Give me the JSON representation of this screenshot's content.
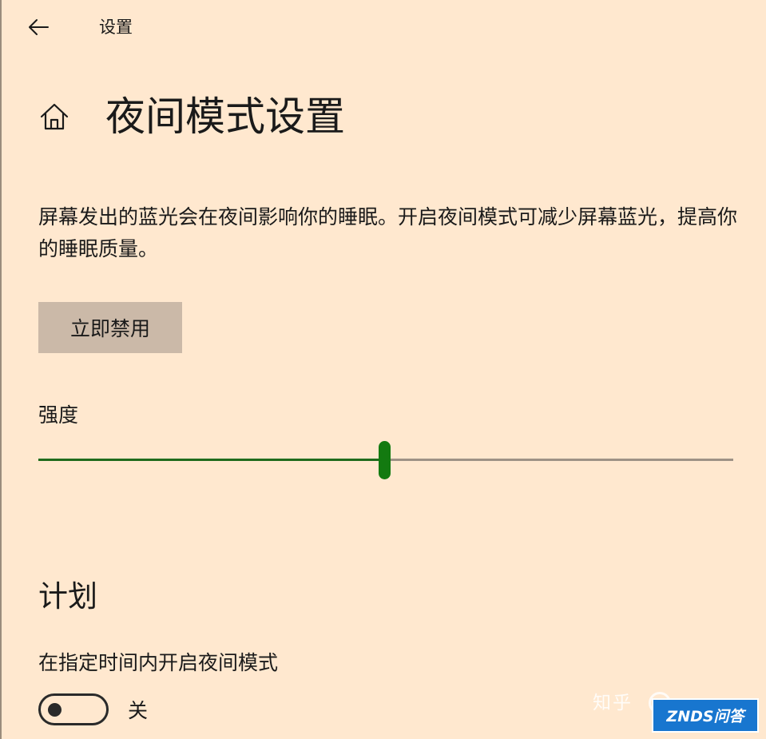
{
  "header": {
    "back_icon": "arrow-left-icon",
    "app_title": "设置"
  },
  "page": {
    "home_icon": "home-icon",
    "title": "夜间模式设置",
    "description": "屏幕发出的蓝光会在夜间影响你的睡眠。开启夜间模式可减少屏幕蓝光，提高你的睡眠质量。"
  },
  "disable_button": {
    "label": "立即禁用"
  },
  "strength": {
    "label": "强度",
    "value_fraction": 0.498
  },
  "schedule": {
    "heading": "计划",
    "toggle_label": "在指定时间内开启夜间模式",
    "toggle_on": false,
    "toggle_state": "关"
  },
  "watermarks": {
    "zhihu": "知乎",
    "znds": "ZNDS问答"
  },
  "colors": {
    "background": "#FFE8CF",
    "button_bg": "#CBB9A8",
    "slider_fill": "#1f6b1c",
    "slider_thumb": "#137a10",
    "slider_track": "#9e9286",
    "znds_brand": "#1876CF"
  }
}
